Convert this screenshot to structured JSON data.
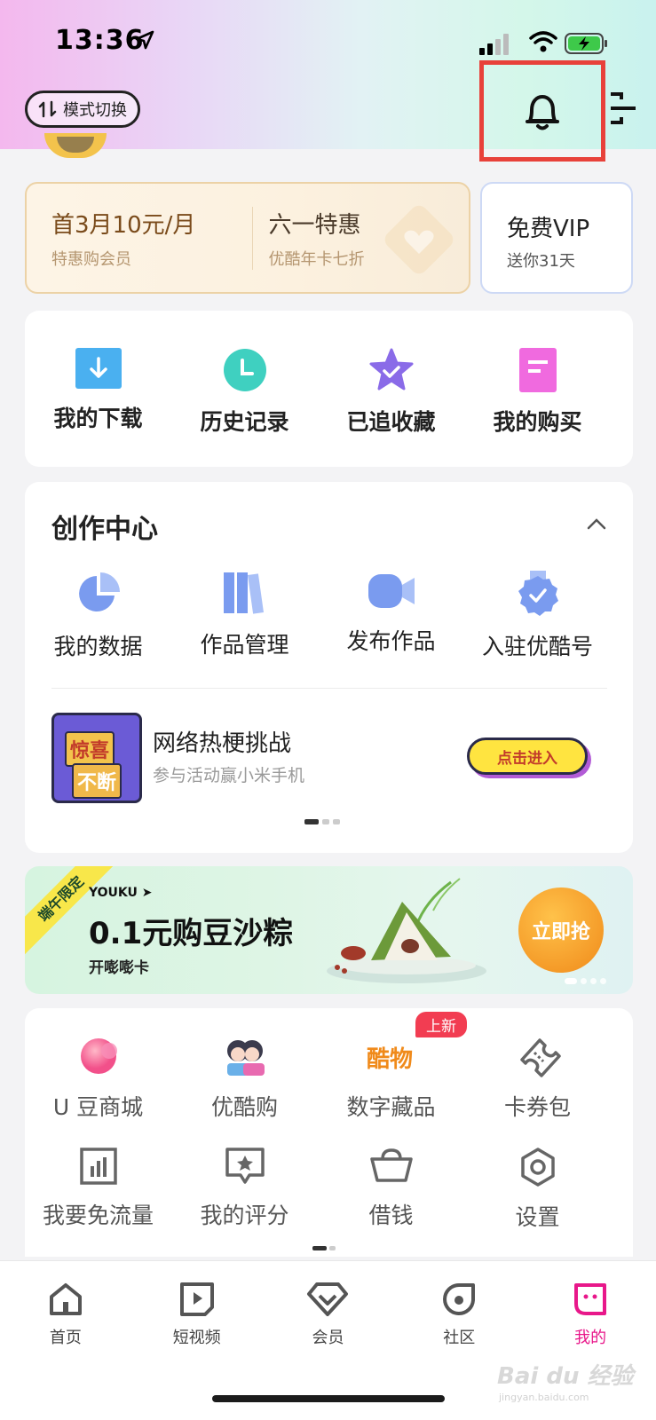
{
  "status_bar": {
    "time": "13:36"
  },
  "header": {
    "mode_switch_label": "模式切换"
  },
  "vip_promo": {
    "offer1_main": "首3月10元/月",
    "offer1_sub": "特惠购会员",
    "offer2_main": "六一特惠",
    "offer2_sub": "优酷年卡七折",
    "free_main": "免费VIP",
    "free_sub": "送你31天"
  },
  "quick_actions": [
    {
      "label": "我的下载",
      "icon": "download-icon"
    },
    {
      "label": "历史记录",
      "icon": "history-icon"
    },
    {
      "label": "已追收藏",
      "icon": "favorite-star-icon"
    },
    {
      "label": "我的购买",
      "icon": "purchase-icon"
    }
  ],
  "creator_center": {
    "title": "创作中心",
    "items": [
      {
        "label": "我的数据",
        "icon": "pie-chart-icon"
      },
      {
        "label": "作品管理",
        "icon": "books-icon"
      },
      {
        "label": "发布作品",
        "icon": "video-camera-icon"
      },
      {
        "label": "入驻优酷号",
        "icon": "verified-badge-icon"
      }
    ],
    "promo": {
      "thumb_line1": "惊喜",
      "thumb_line2": "不断",
      "title": "网络热梗挑战",
      "subtitle": "参与活动赢小米手机",
      "button": "点击进入"
    }
  },
  "banner": {
    "ribbon": "端午限定",
    "brand": "YOUKU ➤",
    "title": "0.1元购豆沙粽",
    "subtitle": "开嘭嘭卡",
    "button": "立即抢"
  },
  "tools": {
    "new_badge": "上新",
    "row1": [
      {
        "label": "U 豆商城",
        "icon": "u-bean-icon"
      },
      {
        "label": "优酷购",
        "icon": "youku-shop-icon"
      },
      {
        "label": "数字藏品",
        "icon": "digital-collection-icon"
      },
      {
        "label": "卡券包",
        "icon": "ticket-icon"
      }
    ],
    "row2": [
      {
        "label": "我要免流量",
        "icon": "data-free-icon"
      },
      {
        "label": "我的评分",
        "icon": "rating-icon"
      },
      {
        "label": "借钱",
        "icon": "gold-ingot-icon"
      },
      {
        "label": "设置",
        "icon": "settings-icon"
      }
    ]
  },
  "tabbar": [
    {
      "label": "首页",
      "icon": "home-icon"
    },
    {
      "label": "短视频",
      "icon": "short-video-icon"
    },
    {
      "label": "会员",
      "icon": "vip-diamond-icon"
    },
    {
      "label": "社区",
      "icon": "community-icon"
    },
    {
      "label": "我的",
      "icon": "my-profile-icon",
      "active": true
    }
  ],
  "watermark": {
    "text": "Bai du 经验",
    "sub": "jingyan.baidu.com"
  },
  "colors": {
    "accent": "#e8178a",
    "highlight_box": "#e8413a"
  }
}
